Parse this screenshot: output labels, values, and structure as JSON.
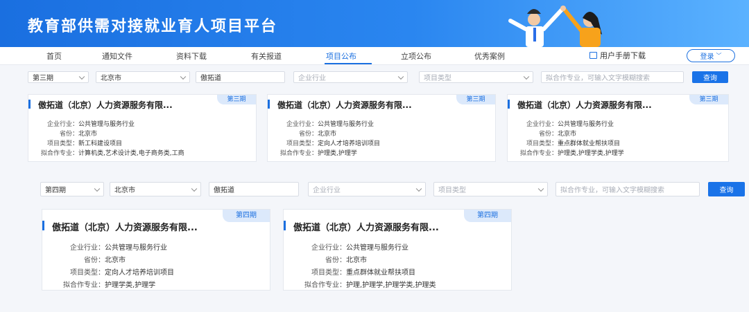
{
  "banner": {
    "title": "教育部供需对接就业育人项目平台"
  },
  "nav": {
    "items": [
      "首页",
      "通知文件",
      "资料下载",
      "有关报道",
      "项目公布",
      "立项公布",
      "优秀案例"
    ],
    "download": "用户手册下载",
    "login": "登录"
  },
  "filters_top": {
    "batch": "第三期",
    "province": "北京市",
    "company": "傲拓道",
    "industry_placeholder": "企业行业",
    "type_placeholder": "项目类型",
    "major_placeholder": "拟合作专业，可输入文字模糊搜索",
    "query": "查询"
  },
  "cards_top": [
    {
      "title": "傲拓道（北京）人力资源服务有限...",
      "badge": "第三期",
      "industry": "公共管理与服务行业",
      "province": "北京市",
      "type": "新工科建设项目",
      "major": "计算机类,艺术设计类,电子商务类,工商"
    },
    {
      "title": "傲拓道（北京）人力资源服务有限...",
      "badge": "第三期",
      "industry": "公共管理与服务行业",
      "province": "北京市",
      "type": "定向人才培养培训项目",
      "major": "护理类,护理学"
    },
    {
      "title": "傲拓道（北京）人力资源服务有限...",
      "badge": "第三期",
      "industry": "公共管理与服务行业",
      "province": "北京市",
      "type": "重点群体就业帮扶项目",
      "major": "护理类,护理学类,护理学"
    }
  ],
  "labels": {
    "industry": "企业行业：",
    "province": "省份：",
    "type": "项目类型：",
    "major": "拟合作专业："
  },
  "filters_bottom": {
    "batch": "第四期",
    "province": "北京市",
    "company": "傲拓道",
    "industry_placeholder": "企业行业",
    "type_placeholder": "项目类型",
    "major_placeholder": "拟合作专业，可输入文字模糊搜索",
    "query": "查询"
  },
  "cards_bottom": [
    {
      "title": "傲拓道（北京）人力资源服务有限...",
      "badge": "第四期",
      "industry": "公共管理与服务行业",
      "province": "北京市",
      "type": "定向人才培养培训项目",
      "major": "护理学类,护理学"
    },
    {
      "title": "傲拓道（北京）人力资源服务有限...",
      "badge": "第四期",
      "industry": "公共管理与服务行业",
      "province": "北京市",
      "type": "重点群体就业帮扶项目",
      "major": "护理,护理学,护理学类,护理类"
    }
  ],
  "colors": {
    "primary": "#1a6fe0",
    "badge_bg": "#dce9fb"
  }
}
